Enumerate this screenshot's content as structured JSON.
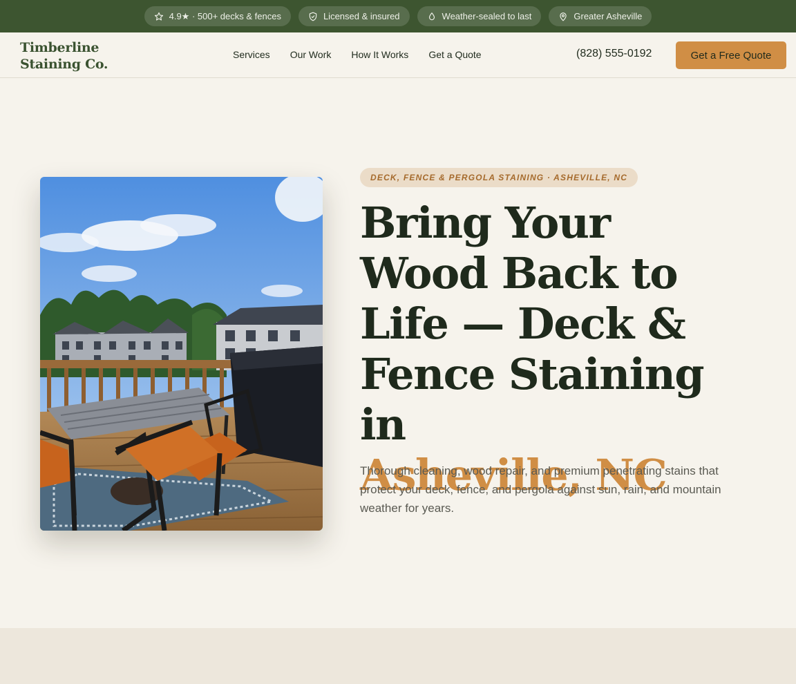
{
  "topbar": {
    "badges": [
      {
        "icon": "star-icon",
        "label": "4.9★ · 500+ decks & fences"
      },
      {
        "icon": "shield-icon",
        "label": "Licensed & insured"
      },
      {
        "icon": "droplet-icon",
        "label": "Weather-sealed to last"
      },
      {
        "icon": "map-pin-icon",
        "label": "Greater Asheville"
      }
    ]
  },
  "header": {
    "logo_line1": "Timberline",
    "logo_line2": "Staining Co.",
    "nav": [
      "Services",
      "Our Work",
      "How It Works",
      "Get a Quote"
    ],
    "phone": "(828) 555-0192",
    "cta_label": "Get a Free Quote"
  },
  "hero": {
    "eyebrow": "DECK, FENCE & PERGOLA STAINING · ASHEVILLE, NC",
    "headline": "Bring Your Wood Back to Life — Deck & Fence Staining in",
    "headline_accent": "Asheville, NC",
    "lead": "Thorough cleaning, wood repair, and premium penetrating stains that protect your deck, fence, and pergola against sun, rain, and mountain weather for years."
  },
  "colors": {
    "brand_green": "#3d5530",
    "accent": "#d08e45",
    "background": "#f6f3ec"
  }
}
